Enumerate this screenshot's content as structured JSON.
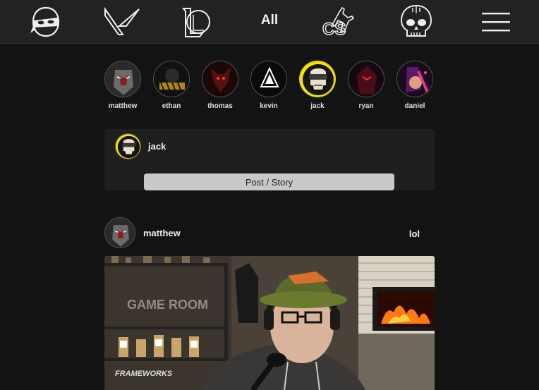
{
  "nav": {
    "items": [
      {
        "icon": "ninja-mask-icon"
      },
      {
        "icon": "valorant-logo-icon"
      },
      {
        "icon": "league-of-legends-logo-icon"
      },
      {
        "icon": "counter-strike-logo-icon"
      },
      {
        "icon": "skull-headset-icon"
      },
      {
        "icon": "hamburger-menu-icon"
      }
    ],
    "all_label": "All"
  },
  "stories": [
    {
      "name": "matthew",
      "accent": "#7a1f1f"
    },
    {
      "name": "ethan",
      "accent": "#b8860b"
    },
    {
      "name": "thomas",
      "accent": "#a01818"
    },
    {
      "name": "kevin",
      "accent": "#ffffff"
    },
    {
      "name": "jack",
      "accent": "#f2e600"
    },
    {
      "name": "ryan",
      "accent": "#c0102a"
    },
    {
      "name": "daniel",
      "accent": "#d62b86"
    }
  ],
  "composer": {
    "user": "jack",
    "button_label": "Post / Story"
  },
  "post": {
    "user": "matthew",
    "text": "lol"
  },
  "colors": {
    "background": "#131313",
    "topbar": "#222222",
    "card": "#1f1f1f",
    "button": "#c8c8c8"
  }
}
